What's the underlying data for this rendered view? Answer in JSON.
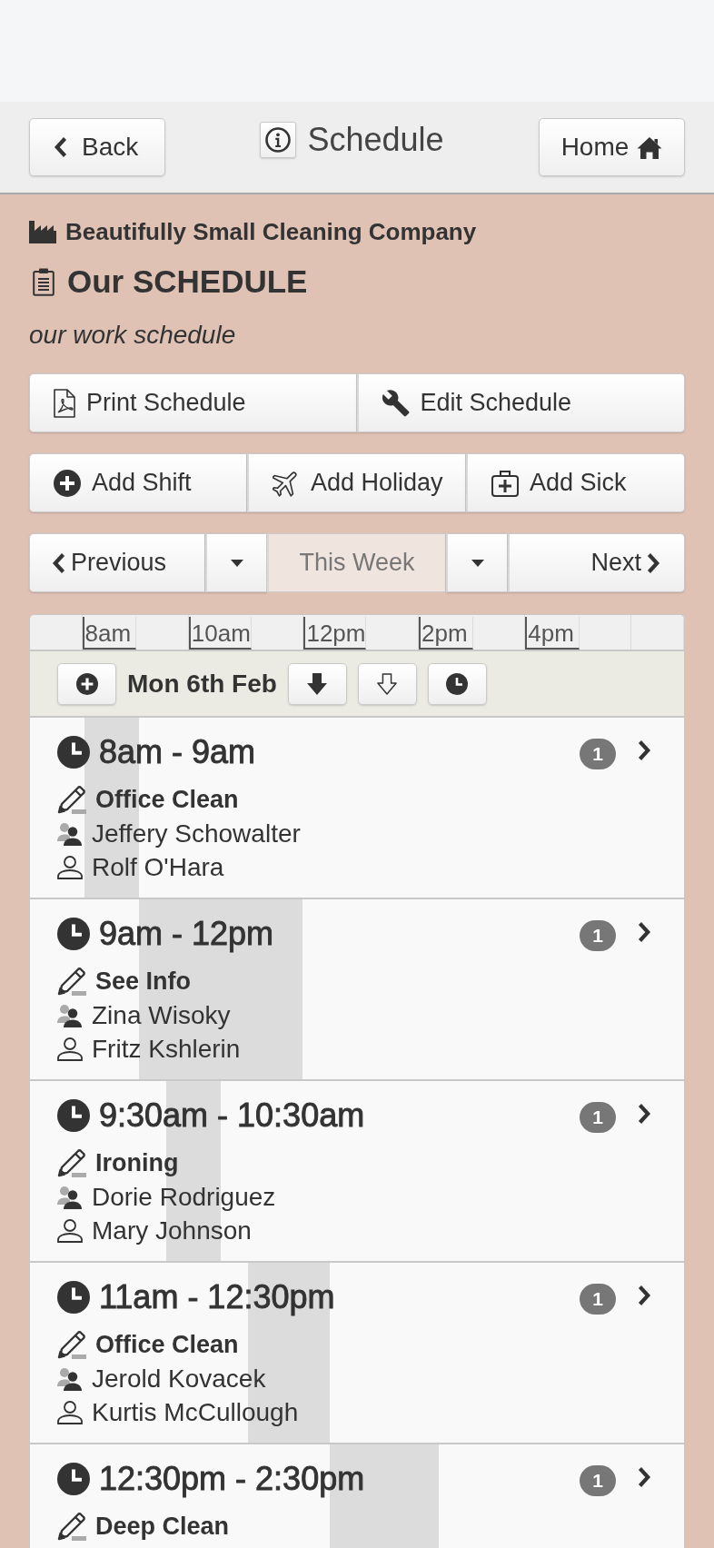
{
  "header": {
    "back": "Back",
    "title": "Schedule",
    "home": "Home"
  },
  "company": "Beautifully Small Cleaning Company",
  "page_title": "Our SCHEDULE",
  "subtitle": "our work schedule",
  "action_groups": [
    {
      "buttons": [
        {
          "kind": "print",
          "label": "Print Schedule"
        },
        {
          "kind": "edit",
          "label": "Edit Schedule"
        }
      ]
    },
    {
      "buttons": [
        {
          "kind": "add_shift",
          "label": "Add Shift"
        },
        {
          "kind": "add_holiday",
          "label": "Add Holiday"
        },
        {
          "kind": "add_sick",
          "label": "Add Sick"
        }
      ]
    }
  ],
  "week_nav": {
    "previous": "Previous",
    "current": {
      "label": "This Week",
      "disabled": true
    },
    "next": "Next"
  },
  "timeline": {
    "labels": [
      "8am",
      "10am",
      "12pm",
      "2pm",
      "4pm"
    ]
  },
  "day": {
    "label": "Mon 6th Feb"
  },
  "shifts": [
    {
      "time": "8am - 9am",
      "count": "1",
      "task": "Office Clean",
      "people": [
        {
          "kind": "staff",
          "name": "Jeffery Schowalter"
        },
        {
          "kind": "client",
          "name": "Rolf O'Hara"
        }
      ]
    },
    {
      "time": "9am - 12pm",
      "count": "1",
      "task": "See Info",
      "people": [
        {
          "kind": "staff",
          "name": "Zina Wisoky"
        },
        {
          "kind": "client",
          "name": "Fritz Kshlerin"
        }
      ]
    },
    {
      "time": "9:30am - 10:30am",
      "count": "1",
      "task": "Ironing",
      "people": [
        {
          "kind": "staff",
          "name": "Dorie Rodriguez"
        },
        {
          "kind": "client",
          "name": "Mary Johnson"
        }
      ]
    },
    {
      "time": "11am - 12:30pm",
      "count": "1",
      "task": "Office Clean",
      "people": [
        {
          "kind": "staff",
          "name": "Jerold Kovacek"
        },
        {
          "kind": "client",
          "name": "Kurtis McCullough"
        }
      ]
    },
    {
      "time": "12:30pm - 2:30pm",
      "count": "1",
      "task": "Deep Clean"
    }
  ]
}
